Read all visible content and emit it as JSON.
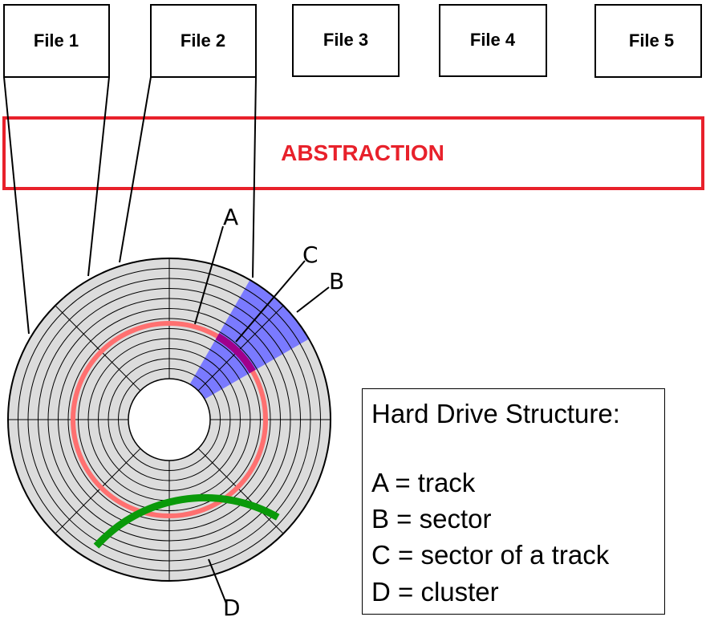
{
  "files": [
    "File 1",
    "File 2",
    "File 3",
    "File 4",
    "File 5"
  ],
  "abstraction": {
    "label": "ABSTRACTION",
    "color": "#e8212b"
  },
  "disk": {
    "track_count": 12,
    "sector_count": 8,
    "colors": {
      "platter": "#dcdcdc",
      "lines": "#000000",
      "track_highlight": "#ff7070",
      "sector_highlight": "#7a7aff",
      "sector_of_track_highlight": "#a0008c",
      "cluster_highlight": "#0a9a0a"
    }
  },
  "markers": {
    "a": "A",
    "b": "B",
    "c": "C",
    "d": "D"
  },
  "legend": {
    "title": "Hard Drive Structure:",
    "entries": [
      "A = track",
      "B = sector",
      "C = sector of a track",
      "D = cluster"
    ]
  }
}
